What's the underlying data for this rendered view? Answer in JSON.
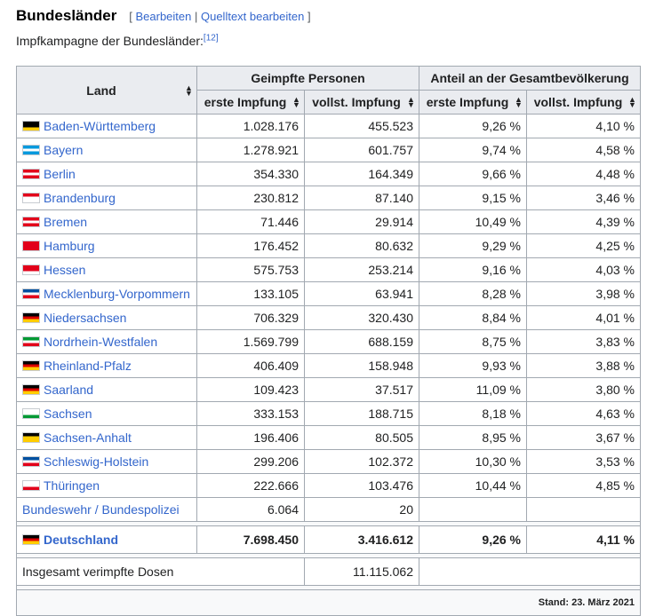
{
  "section": {
    "title": "Bundesländer",
    "edit_open": "[ ",
    "edit_link": "Bearbeiten",
    "edit_sep": " | ",
    "source_link": "Quelltext bearbeiten",
    "edit_close": " ]"
  },
  "intro": {
    "text": "Impfkampagne der Bundesländer:",
    "ref": "[12]"
  },
  "table": {
    "headers": {
      "land": "Land",
      "geimpfte": "Geimpfte Personen",
      "anteil": "Anteil an der Gesamtbevölkerung",
      "erste": "erste Impfung",
      "vollst": "vollst. Impfung"
    },
    "rows": [
      {
        "land": "Baden-Württemberg",
        "erste": "1.028.176",
        "vollst": "455.523",
        "anteil_erste": "9,26 %",
        "anteil_vollst": "4,10 %",
        "flag": [
          "#000000",
          "#000000",
          "#ffcc00"
        ]
      },
      {
        "land": "Bayern",
        "erste": "1.278.921",
        "vollst": "601.757",
        "anteil_erste": "9,74 %",
        "anteil_vollst": "4,58 %",
        "flag": [
          "#0099dd",
          "#ffffff",
          "#0099dd"
        ]
      },
      {
        "land": "Berlin",
        "erste": "354.330",
        "vollst": "164.349",
        "anteil_erste": "9,66 %",
        "anteil_vollst": "4,48 %",
        "flag": [
          "#e2001a",
          "#ffffff",
          "#e2001a"
        ]
      },
      {
        "land": "Brandenburg",
        "erste": "230.812",
        "vollst": "87.140",
        "anteil_erste": "9,15 %",
        "anteil_vollst": "3,46 %",
        "flag": [
          "#e2001a",
          "#ffffff",
          "#ffffff"
        ]
      },
      {
        "land": "Bremen",
        "erste": "71.446",
        "vollst": "29.914",
        "anteil_erste": "10,49 %",
        "anteil_vollst": "4,39 %",
        "flag": [
          "#e2001a",
          "#ffffff",
          "#e2001a"
        ]
      },
      {
        "land": "Hamburg",
        "erste": "176.452",
        "vollst": "80.632",
        "anteil_erste": "9,29 %",
        "anteil_vollst": "4,25 %",
        "flag": [
          "#e2001a",
          "#e2001a",
          "#e2001a"
        ]
      },
      {
        "land": "Hessen",
        "erste": "575.753",
        "vollst": "253.214",
        "anteil_erste": "9,16 %",
        "anteil_vollst": "4,03 %",
        "flag": [
          "#e2001a",
          "#e2001a",
          "#ffffff"
        ]
      },
      {
        "land": "Mecklenburg-Vorpommern",
        "erste": "133.105",
        "vollst": "63.941",
        "anteil_erste": "8,28 %",
        "anteil_vollst": "3,98 %",
        "flag": [
          "#0050a0",
          "#ffffff",
          "#e2001a"
        ]
      },
      {
        "land": "Niedersachsen",
        "erste": "706.329",
        "vollst": "320.430",
        "anteil_erste": "8,84 %",
        "anteil_vollst": "4,01 %",
        "flag": [
          "#000000",
          "#dd0000",
          "#ffcc00"
        ]
      },
      {
        "land": "Nordrhein-Westfalen",
        "erste": "1.569.799",
        "vollst": "688.159",
        "anteil_erste": "8,75 %",
        "anteil_vollst": "3,83 %",
        "flag": [
          "#009933",
          "#ffffff",
          "#e2001a"
        ]
      },
      {
        "land": "Rheinland-Pfalz",
        "erste": "406.409",
        "vollst": "158.948",
        "anteil_erste": "9,93 %",
        "anteil_vollst": "3,88 %",
        "flag": [
          "#000000",
          "#dd0000",
          "#ffcc00"
        ]
      },
      {
        "land": "Saarland",
        "erste": "109.423",
        "vollst": "37.517",
        "anteil_erste": "11,09 %",
        "anteil_vollst": "3,80 %",
        "flag": [
          "#000000",
          "#dd0000",
          "#ffcc00"
        ]
      },
      {
        "land": "Sachsen",
        "erste": "333.153",
        "vollst": "188.715",
        "anteil_erste": "8,18 %",
        "anteil_vollst": "4,63 %",
        "flag": [
          "#ffffff",
          "#ffffff",
          "#009933"
        ]
      },
      {
        "land": "Sachsen-Anhalt",
        "erste": "196.406",
        "vollst": "80.505",
        "anteil_erste": "8,95 %",
        "anteil_vollst": "3,67 %",
        "flag": [
          "#000000",
          "#ffcc00",
          "#ffcc00"
        ]
      },
      {
        "land": "Schleswig-Holstein",
        "erste": "299.206",
        "vollst": "102.372",
        "anteil_erste": "10,30 %",
        "anteil_vollst": "3,53 %",
        "flag": [
          "#0050a0",
          "#ffffff",
          "#e2001a"
        ]
      },
      {
        "land": "Thüringen",
        "erste": "222.666",
        "vollst": "103.476",
        "anteil_erste": "10,44 %",
        "anteil_vollst": "4,85 %",
        "flag": [
          "#ffffff",
          "#ffffff",
          "#e2001a"
        ]
      }
    ],
    "federal": {
      "land": "Bundeswehr / Bundespolizei",
      "erste": "6.064",
      "vollst": "20"
    },
    "total": {
      "land": "Deutschland",
      "erste": "7.698.450",
      "vollst": "3.416.612",
      "anteil_erste": "9,26 %",
      "anteil_vollst": "4,11 %",
      "flag": [
        "#000000",
        "#dd0000",
        "#ffcc00"
      ]
    },
    "doses": {
      "label": "Insgesamt verimpfte Dosen",
      "value": "11.115.062"
    },
    "stand": "Stand: 23. März 2021"
  },
  "colors": {
    "link": "#3366cc",
    "header_bg": "#eaecf0",
    "border": "#a2a9b1"
  }
}
